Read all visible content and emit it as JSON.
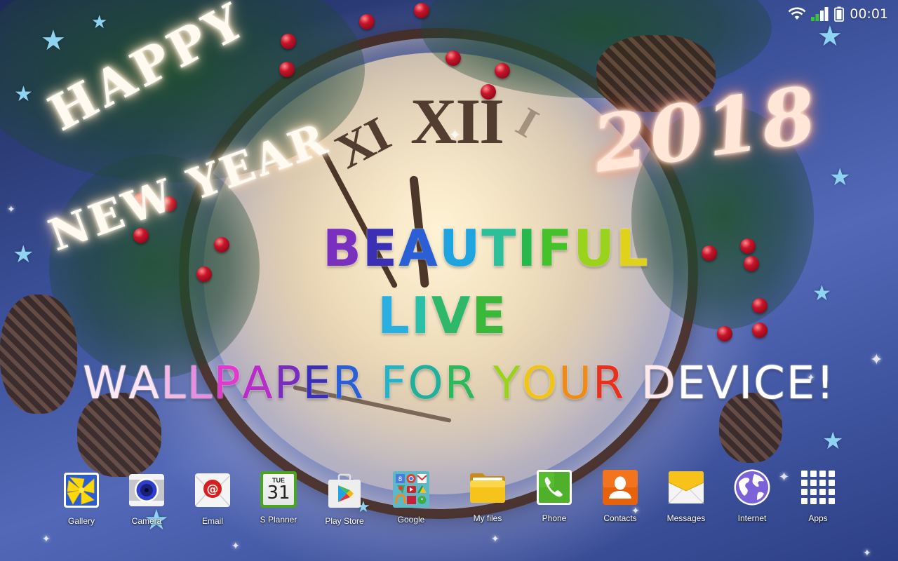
{
  "status_bar": {
    "icons": [
      "wifi-icon",
      "cellular-signal-icon",
      "battery-icon"
    ],
    "time": "00:01"
  },
  "wallpaper": {
    "greeting_line_1": "HAPPY",
    "greeting_line_2": "NEW YEAR",
    "year": "2018",
    "clock_numerals": [
      "XII",
      "XI",
      "I"
    ],
    "promo_line_1": [
      {
        "t": "B",
        "c": "#7b2fbf"
      },
      {
        "t": "E",
        "c": "#3a2fb5"
      },
      {
        "t": "A",
        "c": "#2a5fd6"
      },
      {
        "t": "U",
        "c": "#1fa4e0"
      },
      {
        "t": "T",
        "c": "#2dbf9a"
      },
      {
        "t": "I",
        "c": "#27b84c"
      },
      {
        "t": "F",
        "c": "#45c22a"
      },
      {
        "t": "U",
        "c": "#9bd21c"
      },
      {
        "t": "L",
        "c": "#e0d21a"
      }
    ],
    "promo_line_2": [
      {
        "t": "L",
        "c": "#2ab0e0"
      },
      {
        "t": "I",
        "c": "#2ac0a8"
      },
      {
        "t": "V",
        "c": "#2fb86a"
      },
      {
        "t": "E",
        "c": "#39b83a"
      }
    ],
    "promo_line_3": [
      {
        "t": "W",
        "c": "#fbe8f4"
      },
      {
        "t": "A",
        "c": "#fbe3f2"
      },
      {
        "t": "L",
        "c": "#f2b8e6"
      },
      {
        "t": "L",
        "c": "#e98de0"
      },
      {
        "t": "P",
        "c": "#e23ad0"
      },
      {
        "t": "A",
        "c": "#b82cc8"
      },
      {
        "t": "P",
        "c": "#7a2cbf"
      },
      {
        "t": "E",
        "c": "#3b2fb8"
      },
      {
        "t": "R",
        "c": "#2a5fd6"
      },
      {
        "t": " ",
        "c": "#ffffff"
      },
      {
        "t": "F",
        "c": "#22b5c8"
      },
      {
        "t": "O",
        "c": "#22b09a"
      },
      {
        "t": "R",
        "c": "#2db85a"
      },
      {
        "t": " ",
        "c": "#ffffff"
      },
      {
        "t": "Y",
        "c": "#9bd21c"
      },
      {
        "t": "O",
        "c": "#f0c418"
      },
      {
        "t": "U",
        "c": "#f08a18"
      },
      {
        "t": "R",
        "c": "#e8301c"
      },
      {
        "t": " ",
        "c": "#ffffff"
      },
      {
        "t": "D",
        "c": "#ffe8ec"
      },
      {
        "t": "E",
        "c": "#ffffff"
      },
      {
        "t": "V",
        "c": "#ffffff"
      },
      {
        "t": "I",
        "c": "#ffffff"
      },
      {
        "t": "C",
        "c": "#ffffff"
      },
      {
        "t": "E",
        "c": "#ffffff"
      },
      {
        "t": "!",
        "c": "#ffffff"
      }
    ]
  },
  "dock": {
    "apps": [
      {
        "label": "Gallery",
        "icon": "gallery-icon"
      },
      {
        "label": "Camera",
        "icon": "camera-icon"
      },
      {
        "label": "Email",
        "icon": "email-icon"
      },
      {
        "label": "S Planner",
        "icon": "calendar-icon",
        "day": "TUE",
        "date": "31"
      },
      {
        "label": "Play Store",
        "icon": "play-store-icon"
      },
      {
        "label": "Google",
        "icon": "google-folder-icon"
      },
      {
        "label": "My files",
        "icon": "folder-icon"
      },
      {
        "label": "Phone",
        "icon": "phone-icon"
      },
      {
        "label": "Contacts",
        "icon": "contacts-icon"
      },
      {
        "label": "Messages",
        "icon": "messages-icon"
      },
      {
        "label": "Internet",
        "icon": "globe-icon"
      },
      {
        "label": "Apps",
        "icon": "app-grid-icon"
      }
    ]
  }
}
